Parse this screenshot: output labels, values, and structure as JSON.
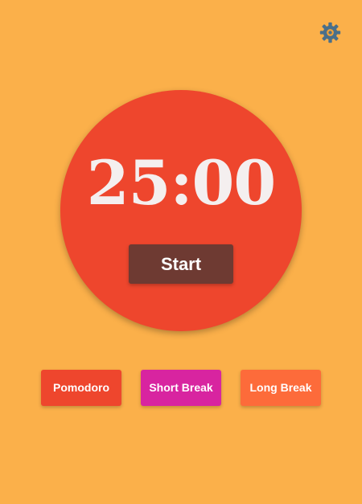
{
  "header": {
    "settings_icon": "gear-icon"
  },
  "timer": {
    "display": "25:00",
    "start_label": "Start"
  },
  "modes": [
    {
      "label": "Pomodoro"
    },
    {
      "label": "Short Break"
    },
    {
      "label": "Long Break"
    }
  ],
  "colors": {
    "background": "#fbb04a",
    "circle": "#ee462d",
    "start_button": "#6e3a32",
    "pomodoro": "#ee462d",
    "short_break": "#d824a0",
    "long_break": "#fd6b3a",
    "gear": "#4a6f8a",
    "gear_hub": "#f0a23a"
  }
}
